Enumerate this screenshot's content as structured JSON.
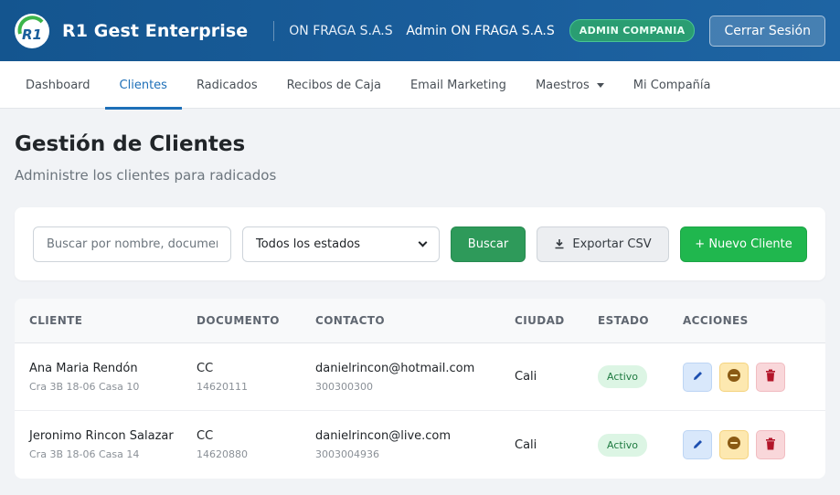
{
  "header": {
    "brand": "R1 Gest Enterprise",
    "logo_text": "R1",
    "company": "ON FRAGA S.A.S",
    "admin_name": "Admin ON FRAGA S.A.S",
    "role_badge": "ADMIN COMPANIA",
    "logout_label": "Cerrar Sesión"
  },
  "nav": {
    "items": [
      {
        "label": "Dashboard"
      },
      {
        "label": "Clientes",
        "active": true
      },
      {
        "label": "Radicados"
      },
      {
        "label": "Recibos de Caja"
      },
      {
        "label": "Email Marketing"
      },
      {
        "label": "Maestros",
        "dropdown": true
      },
      {
        "label": "Mi Compañía"
      }
    ]
  },
  "page": {
    "title": "Gestión de Clientes",
    "subtitle": "Administre los clientes para radicados"
  },
  "filters": {
    "search_placeholder": "Buscar por nombre, documento...",
    "search_value": "",
    "status_selected": "Todos los estados",
    "search_button": "Buscar",
    "export_button": "Exportar CSV",
    "new_button": "+ Nuevo Cliente"
  },
  "table": {
    "headers": [
      "CLIENTE",
      "DOCUMENTO",
      "CONTACTO",
      "CIUDAD",
      "ESTADO",
      "ACCIONES"
    ],
    "rows": [
      {
        "name": "Ana Maria Rendón",
        "address": "Cra 3B 18-06 Casa 10",
        "doc_type": "CC",
        "doc_number": "14620111",
        "email": "danielrincon@hotmail.com",
        "phone": "300300300",
        "city": "Cali",
        "status": "Activo"
      },
      {
        "name": "Jeronimo Rincon Salazar",
        "address": "Cra 3B 18-06 Casa 14",
        "doc_type": "CC",
        "doc_number": "14620880",
        "email": "danielrincon@live.com",
        "phone": "3003004936",
        "city": "Cali",
        "status": "Activo"
      }
    ]
  },
  "colors": {
    "header_bg": "#1a5e9c",
    "accent": "#1d6fb8",
    "success": "#20b74e",
    "badge": "#2a9d72"
  },
  "icons": {
    "edit": "pencil-icon",
    "disable": "minus-circle-icon",
    "delete": "trash-icon",
    "export": "download-icon"
  }
}
